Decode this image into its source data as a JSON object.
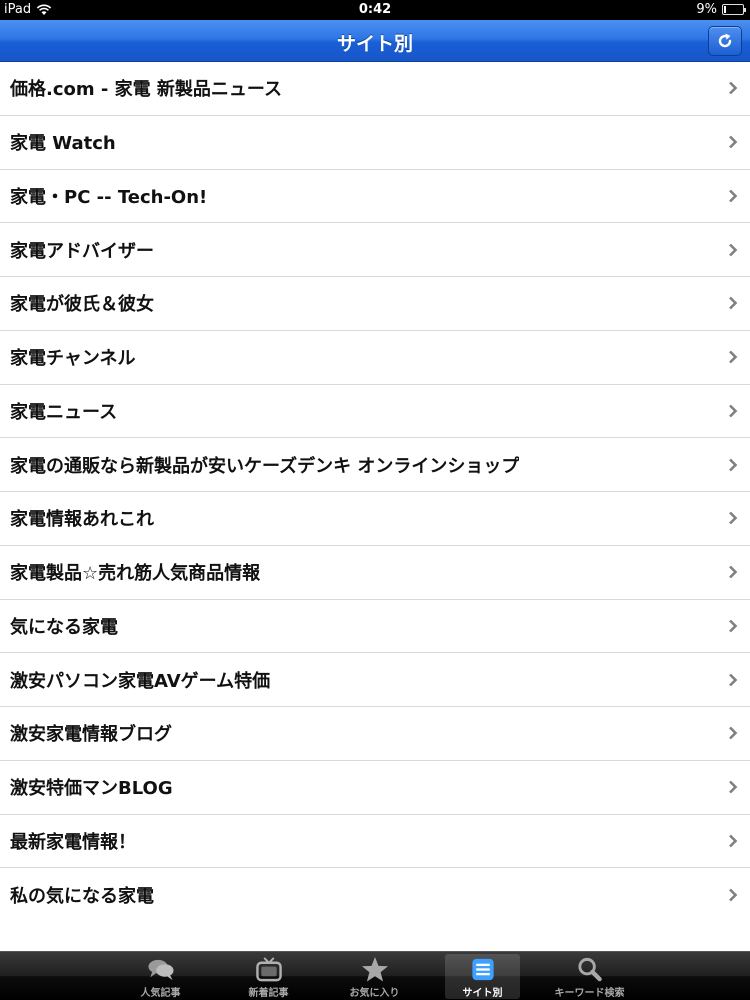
{
  "status_bar": {
    "device": "iPad",
    "time": "0:42",
    "battery": "9%",
    "battery_level": 0.09
  },
  "nav": {
    "title": "サイト別"
  },
  "list": {
    "items": [
      "価格.com - 家電 新製品ニュース",
      "家電 Watch",
      "家電・PC -- Tech-On!",
      "家電アドバイザー",
      "家電が彼氏＆彼女",
      "家電チャンネル",
      "家電ニュース",
      "家電の通販なら新製品が安いケーズデンキ オンラインショップ",
      "家電情報あれこれ",
      "家電製品☆売れ筋人気商品情報",
      "気になる家電",
      "激安パソコン家電AVゲーム特価",
      "激安家電情報ブログ",
      "激安特価マンBLOG",
      "最新家電情報！",
      "私の気になる家電"
    ]
  },
  "tabs": [
    {
      "label": "人気記事",
      "icon": "chat-bubbles-icon"
    },
    {
      "label": "新着記事",
      "icon": "tv-icon"
    },
    {
      "label": "お気に入り",
      "icon": "star-icon"
    },
    {
      "label": "サイト別",
      "icon": "list-icon",
      "selected": true
    },
    {
      "label": "キーワード検索",
      "icon": "search-icon"
    }
  ],
  "colors": {
    "nav_blue": "#2f76e6",
    "tab_selected": "#ffffff",
    "tab_unselected": "#a8a8a8"
  }
}
